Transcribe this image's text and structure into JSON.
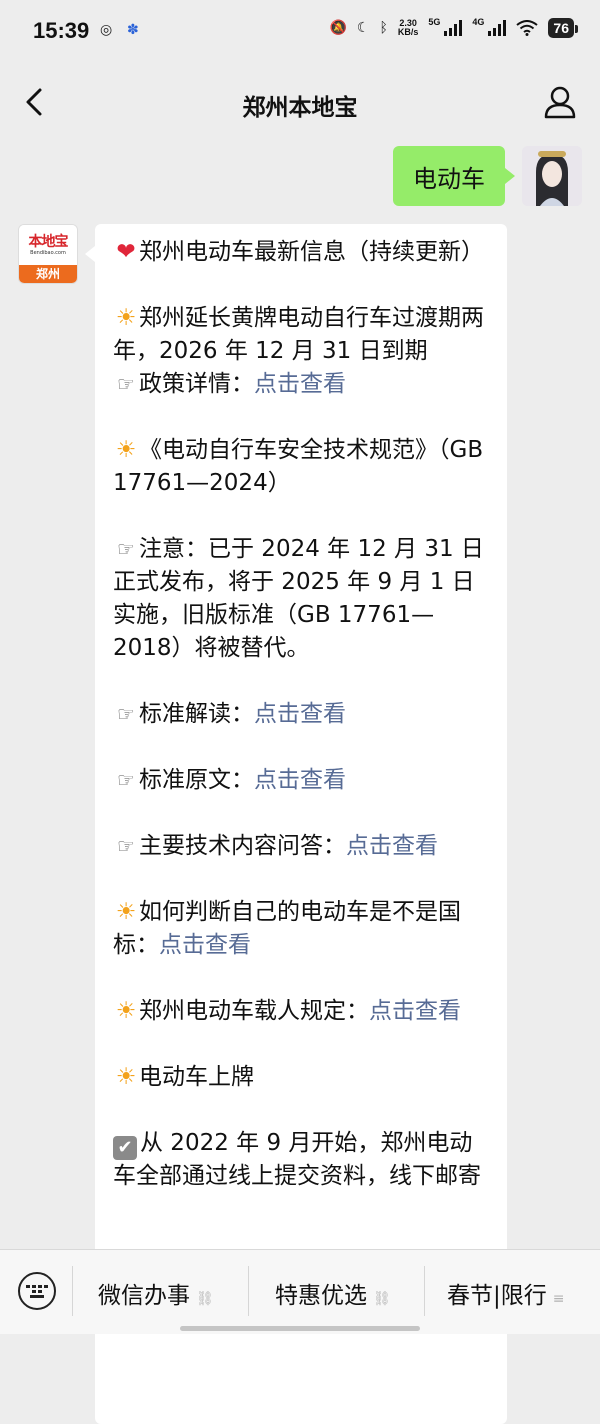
{
  "status_bar": {
    "time": "15:39",
    "net_speed": "2.30",
    "net_unit": "KB/s",
    "gen1": "5G",
    "gen2": "4G",
    "battery": "76"
  },
  "nav": {
    "title": "郑州本地宝"
  },
  "outgoing": {
    "text": "电动车"
  },
  "bot_avatar": {
    "logo": "本地宝",
    "logo_sub": "Bendibao.com",
    "city": "郑州"
  },
  "message": {
    "p1": "郑州电动车最新信息（持续更新）",
    "p2a": "郑州延长黄牌电动自行车过渡期两年，2026 年 12 月 31 日到期",
    "p2b": "政策详情：",
    "p3": "《电动自行车安全技术规范》（GB 17761—2024）",
    "p4": "注意：已于 2024 年 12 月 31 日正式发布，将于 2025 年 9 月 1 日实施，旧版标准（GB 17761—2018）将被替代。",
    "p5": "标准解读：",
    "p6": "标准原文：",
    "p7": "主要技术内容问答：",
    "p8": "如何判断自己的电动车是不是国标：",
    "p9": "郑州电动车载人规定：",
    "p10": "电动车上牌",
    "p11": "从 2022 年 9 月开始，郑州电动车全部通过线上提交资料，线下邮寄",
    "link": "点击查看"
  },
  "bottom_menu": {
    "m1": "微信办事",
    "m2": "特惠优选",
    "m3": "春节|限行"
  }
}
